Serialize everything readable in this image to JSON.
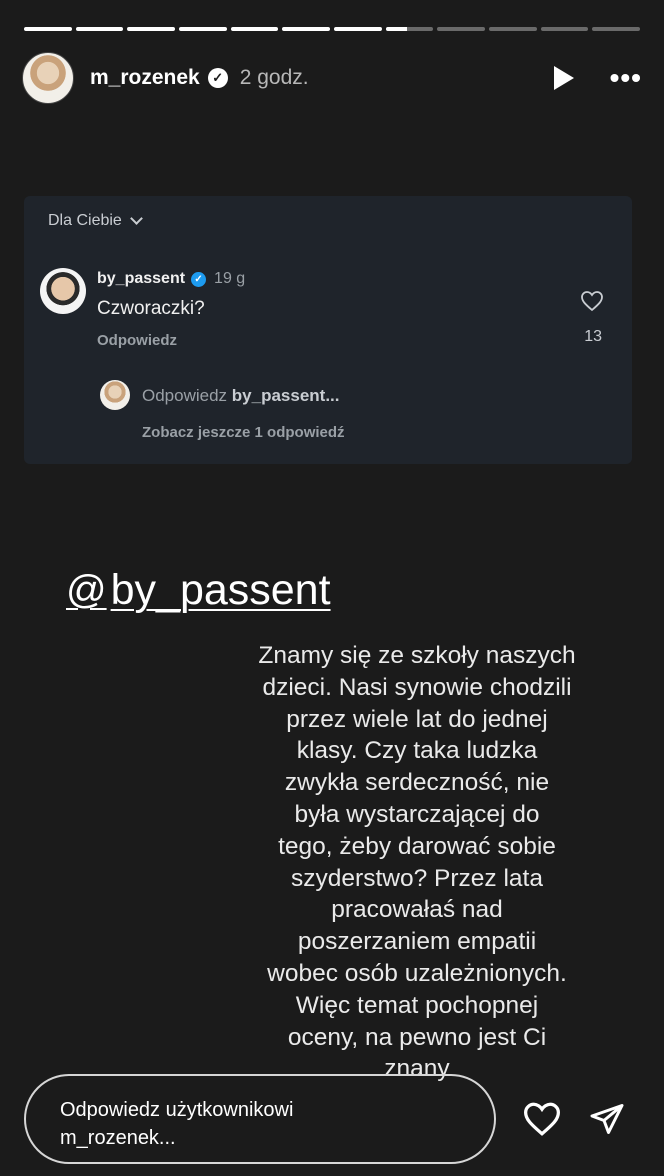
{
  "progress": {
    "segments": 12,
    "completed": 7,
    "current_fraction": 0.45
  },
  "header": {
    "username": "m_rozenek",
    "verified_icon": "verified-badge",
    "time": "2 godz.",
    "play_icon": "play-icon",
    "more_icon": "more-icon"
  },
  "card": {
    "feed_label": "Dla Ciebie",
    "comment": {
      "user": "by_passent",
      "time": "19 g",
      "text": "Czworaczki?",
      "reply_label": "Odpowiedz",
      "likes": "13"
    },
    "reply_prompt_prefix": "Odpowiedz",
    "reply_prompt_user": "by_passent...",
    "more_replies": "Zobacz jeszcze 1 odpowiedź"
  },
  "mention": {
    "symbol": "@",
    "text": "by_passent"
  },
  "story_text": [
    "Znamy się ze szkoły naszych",
    "dzieci. Nasi synowie chodzili",
    "przez wiele lat do jednej",
    "klasy. Czy taka ludzka",
    "zwykła serdeczność, nie",
    "była wystarczającej do",
    "tego, żeby darować sobie",
    "szyderstwo?  Przez lata",
    "pracowałaś nad",
    "poszerzaniem empatii",
    "wobec osób uzależnionych.",
    "Więc temat pochopnej",
    "oceny, na pewno jest Ci",
    "znany"
  ],
  "footer": {
    "reply_line1": "Odpowiedz użytkownikowi",
    "reply_line2": "m_rozenek...",
    "heart_icon": "heart-icon",
    "send_icon": "send-icon"
  }
}
